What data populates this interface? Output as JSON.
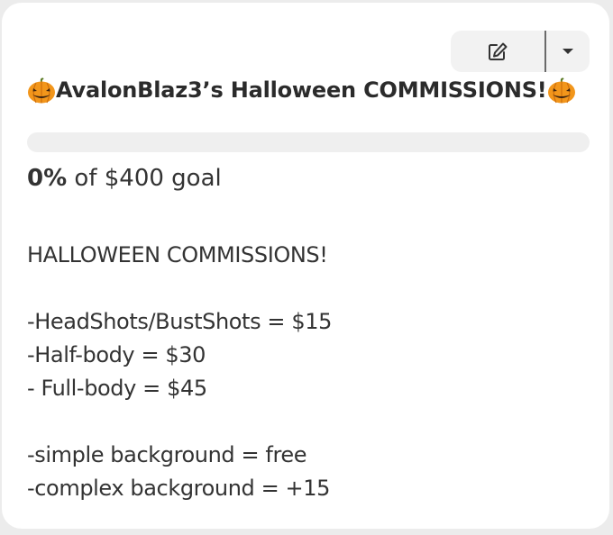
{
  "title": {
    "text": "AvalonBlaz3’s Halloween COMMISSIONS!",
    "leading_icon": "jack-o-lantern",
    "trailing_icon": "jack-o-lantern"
  },
  "toolbar": {
    "edit_icon": "edit-pencil-icon",
    "dropdown_icon": "caret-down-icon"
  },
  "progress": {
    "percent_value": 0,
    "percent_label": "0%",
    "goal_text": " of $400 goal",
    "track_color": "#efefef"
  },
  "description": {
    "heading": "HALLOWEEN COMMISSIONS!",
    "prices": [
      "-HeadShots/BustShots = $15",
      "-Half-body = $30",
      "- Full-body = $45"
    ],
    "backgrounds": [
      "-simple background = free",
      "-complex background = +15"
    ]
  }
}
